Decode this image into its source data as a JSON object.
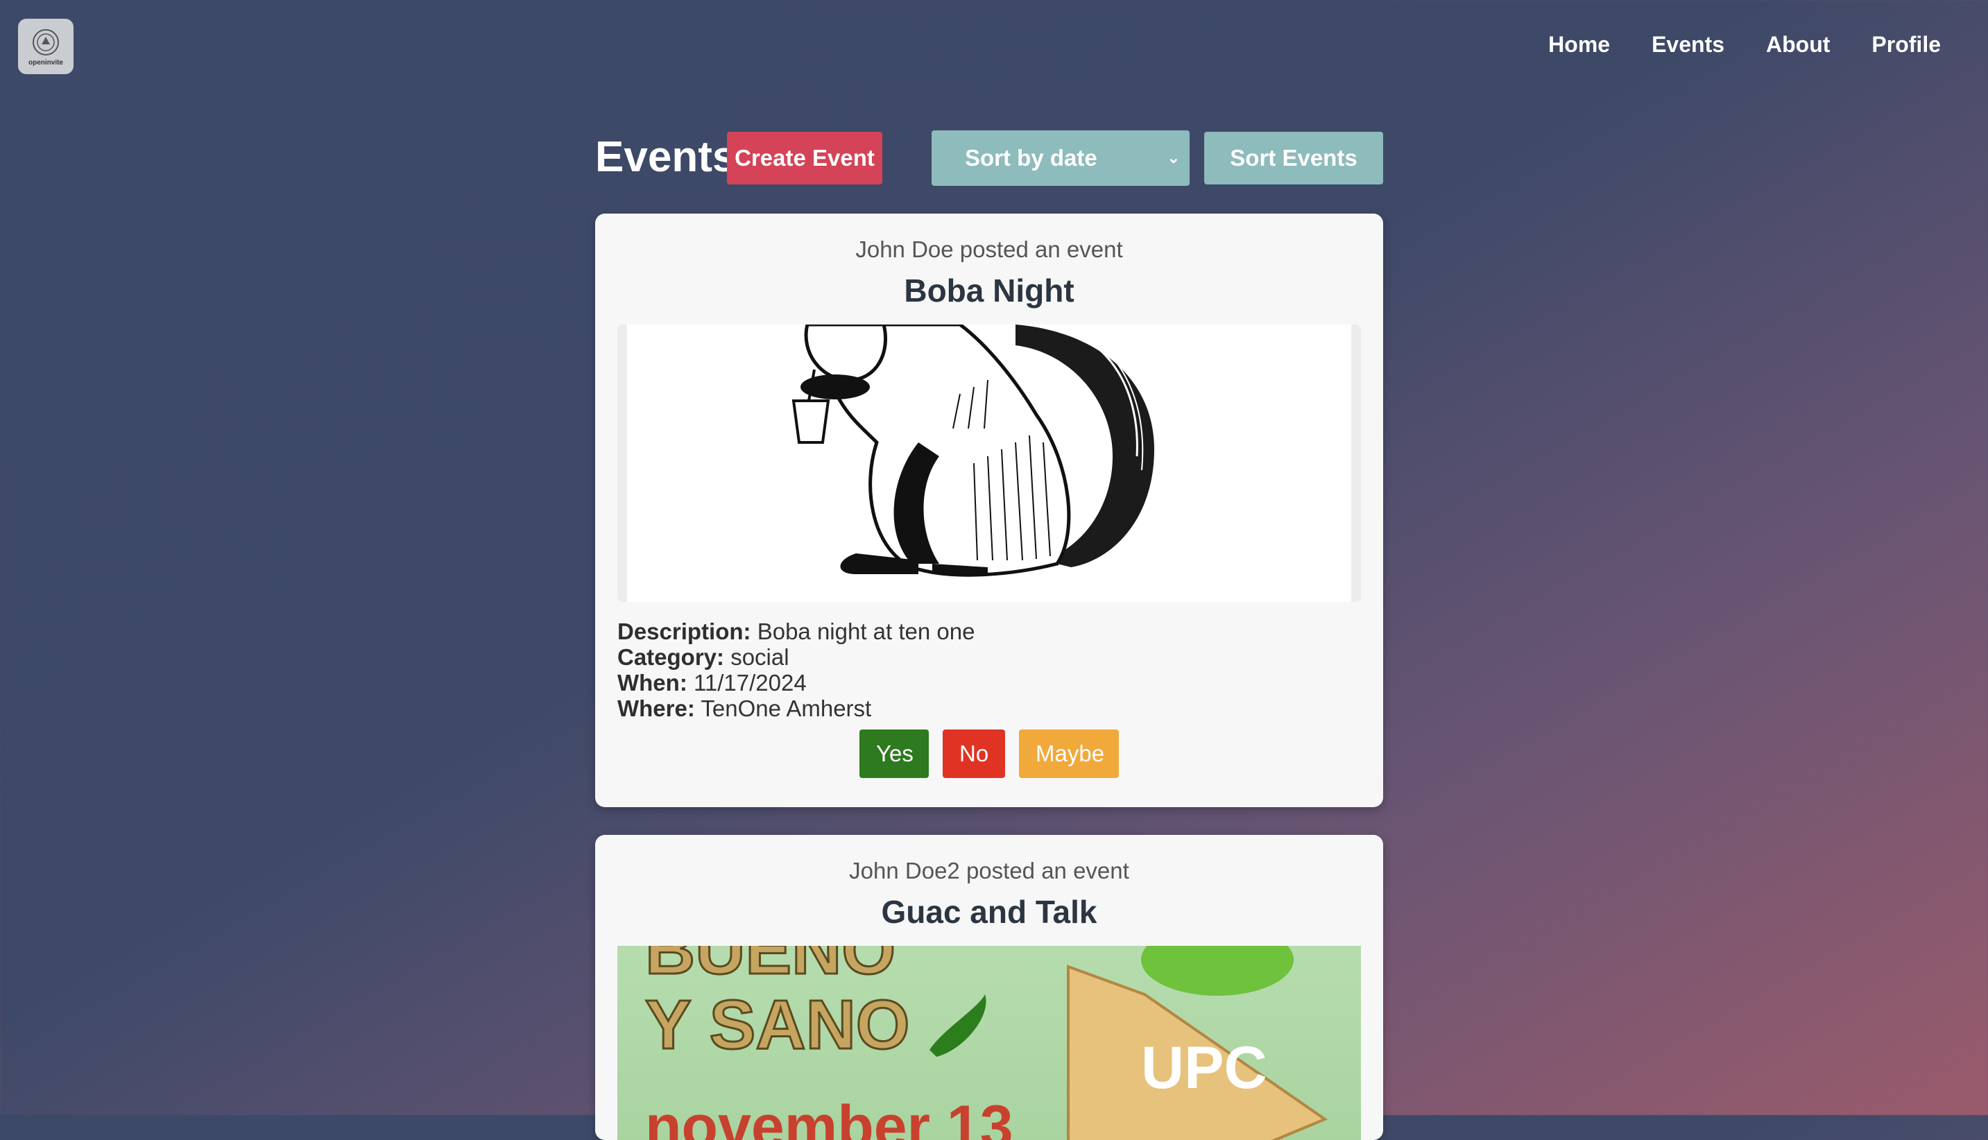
{
  "app": {
    "logo_text": "openinvite"
  },
  "nav": {
    "items": [
      "Home",
      "Events",
      "About",
      "Profile"
    ]
  },
  "toolbar": {
    "title": "Events",
    "create_label": "Create Event",
    "sort_selected": "Sort by date",
    "sort_label": "Sort Events"
  },
  "events": [
    {
      "posted_by": "John Doe posted an event",
      "title": "Boba Night",
      "description_label": "Description:",
      "description": "Boba night at ten one",
      "category_label": "Category:",
      "category": "social",
      "when_label": "When:",
      "when": "11/17/2024",
      "where_label": "Where:",
      "where": "TenOne Amherst",
      "image_icon": "squirrel-drinking-boba-illustration",
      "rsvp": {
        "yes": "Yes",
        "no": "No",
        "maybe": "Maybe"
      }
    },
    {
      "posted_by": "John Doe2 posted an event",
      "title": "Guac and Talk",
      "image_text": {
        "line1": "BUENO",
        "line2": "Y SANO",
        "line3": "november 13",
        "badge": "UPC"
      }
    }
  ],
  "colors": {
    "create": "#d54358",
    "sort": "#8ebbbc",
    "yes": "#2e7a1f",
    "no": "#e03324",
    "maybe": "#f1a93b"
  }
}
